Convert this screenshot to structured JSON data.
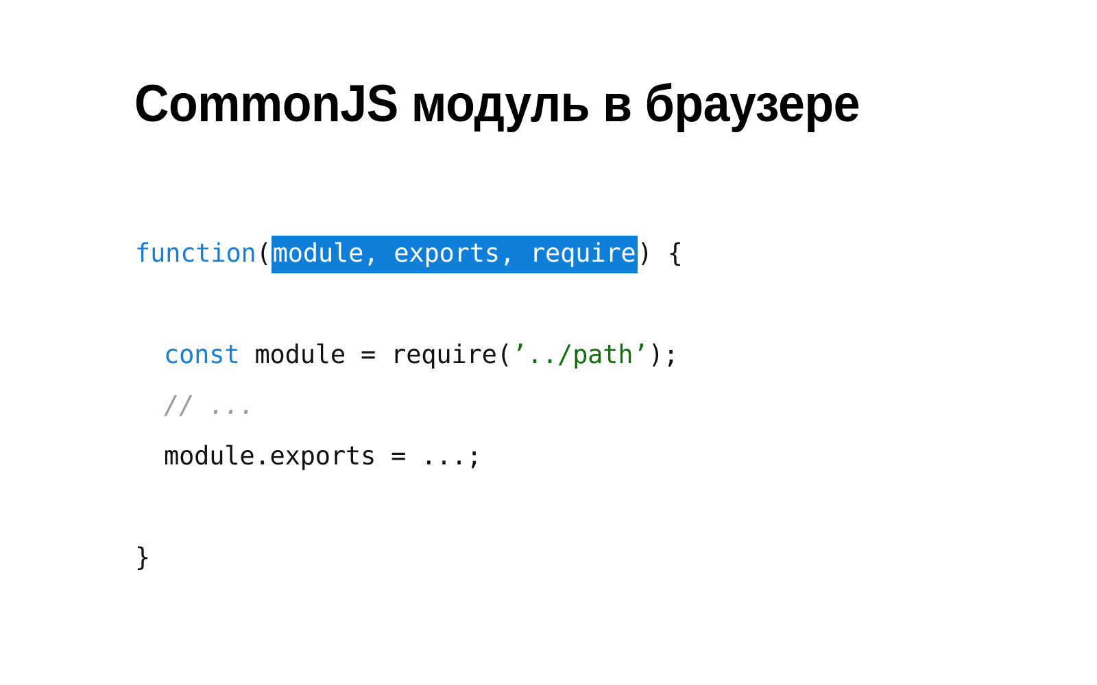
{
  "slide": {
    "title": "CommonJS модуль в браузере",
    "background_color": "#ffffff"
  },
  "colors": {
    "keyword": "#1a7fd4",
    "string": "#107010",
    "comment": "#9a9a9a",
    "plain": "#111111",
    "highlight_background": "#0f7fd9",
    "highlight_text": "#ffffff",
    "title": "#000000"
  },
  "code": {
    "language": "javascript",
    "full_text": "function(module, exports, require) {\n\n  const module = require('../path');\n  // ...\n  module.exports = ...;\n\n}",
    "lines": [
      {
        "index": 1,
        "indent": false,
        "tokens": [
          {
            "text": "function",
            "type": "keyword"
          },
          {
            "text": "(",
            "type": "plain"
          },
          {
            "text": "module, exports, require",
            "type": "highlight"
          },
          {
            "text": ")",
            "type": "plain"
          },
          {
            "text": " {",
            "type": "plain"
          }
        ]
      },
      {
        "index": 2,
        "indent": false,
        "blank": true,
        "tokens": []
      },
      {
        "index": 3,
        "indent": true,
        "tokens": [
          {
            "text": "const",
            "type": "keyword"
          },
          {
            "text": " module = require(",
            "type": "plain"
          },
          {
            "text": "’../path’",
            "type": "string"
          },
          {
            "text": ");",
            "type": "plain"
          }
        ]
      },
      {
        "index": 4,
        "indent": true,
        "tokens": [
          {
            "text": "// ...",
            "type": "comment"
          }
        ]
      },
      {
        "index": 5,
        "indent": true,
        "tokens": [
          {
            "text": "module.exports = ...;",
            "type": "plain"
          }
        ]
      },
      {
        "index": 6,
        "indent": false,
        "blank": true,
        "tokens": []
      },
      {
        "index": 7,
        "indent": false,
        "tokens": [
          {
            "text": "}",
            "type": "plain"
          }
        ]
      }
    ]
  }
}
